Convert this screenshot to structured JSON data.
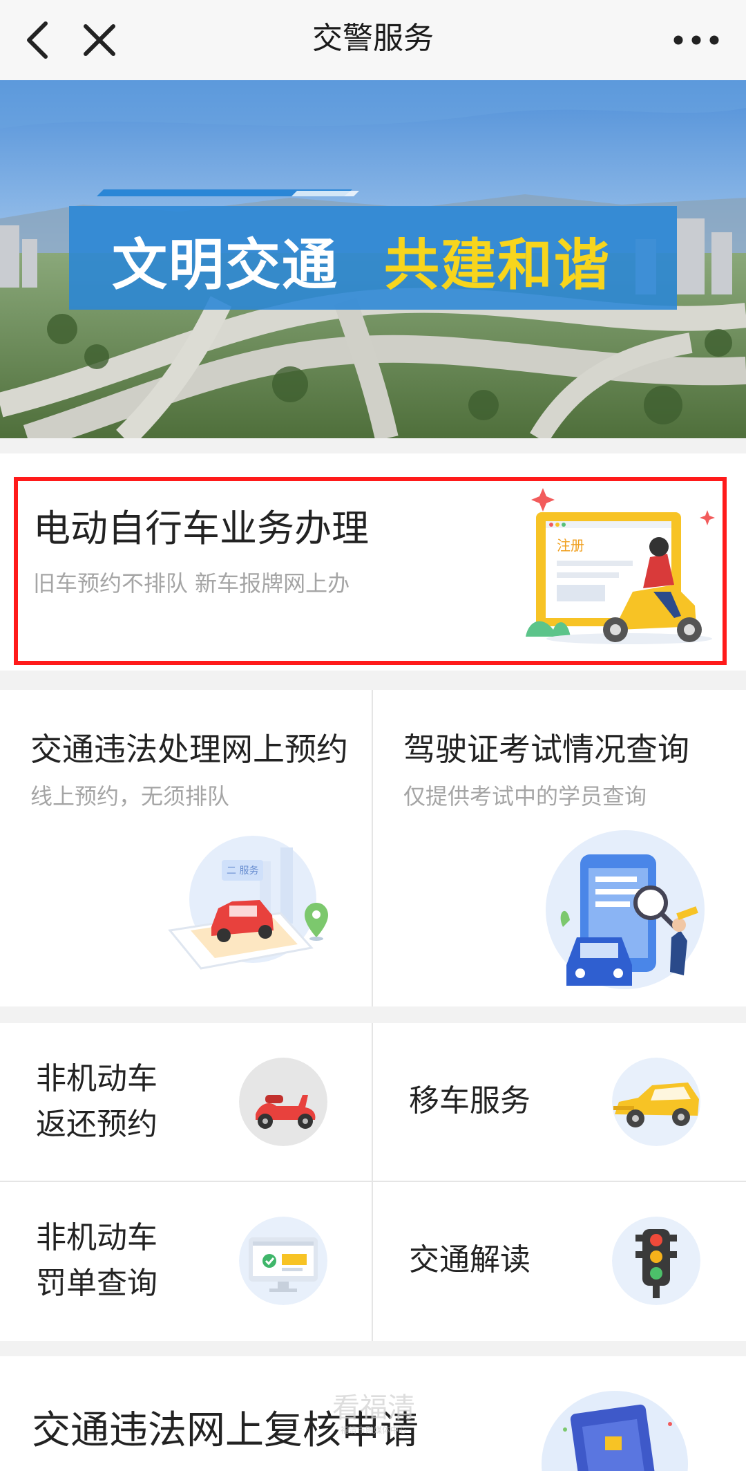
{
  "header": {
    "title": "交警服务",
    "back_icon": "back-arrow-icon",
    "close_icon": "close-icon",
    "more_icon": "more-icon"
  },
  "banner": {
    "text_white": "文明交通",
    "text_yellow": "共建和谐"
  },
  "ebike": {
    "title": "电动自行车业务办理",
    "subtitle": "旧车预约不排队 新车报牌网上办",
    "illustration_label": "注册",
    "highlight_color": "#ff1a1a"
  },
  "tiles": [
    {
      "title": "交通违法处理网上预约",
      "subtitle": "线上预约，无须排队",
      "illustration_label": "二 服务"
    },
    {
      "title": "驾驶证考试情况查询",
      "subtitle": "仅提供考试中的学员查询"
    }
  ],
  "services": [
    {
      "line1": "非机动车",
      "line2": "返还预约",
      "icon": "scooter-icon"
    },
    {
      "line1": "移车服务",
      "icon": "car-icon"
    },
    {
      "line1": "非机动车",
      "line2": "罚单查询",
      "icon": "monitor-check-icon"
    },
    {
      "line1": "交通解读",
      "icon": "traffic-light-icon"
    }
  ],
  "review": {
    "title": "交通违法网上复核申请"
  },
  "watermark": {
    "text": "看福清",
    "small": "福清市融媒体中心"
  },
  "colors": {
    "brand_blue": "#2a86d6",
    "accent_yellow": "#f7c325",
    "light_circle": "#e8f0fb"
  }
}
